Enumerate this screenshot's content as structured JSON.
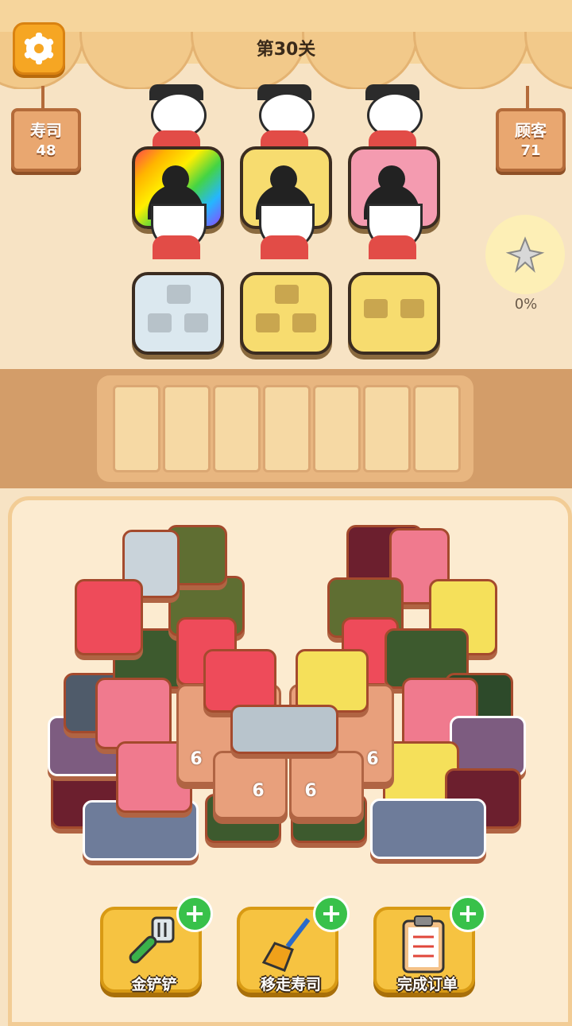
{
  "header": {
    "level_title": "第30关",
    "settings_icon": "gear-icon"
  },
  "signs": {
    "sushi": {
      "label": "寿司",
      "count": "48"
    },
    "customers": {
      "label": "顾客",
      "count": "71"
    }
  },
  "progress": {
    "percent_label": "0%",
    "value": 0
  },
  "orders_top": [
    {
      "box_color": "rainbow"
    },
    {
      "box_color": "#f7dc6f"
    },
    {
      "box_color": "#f49bb0"
    }
  ],
  "orders_front": [
    {
      "box_color": "#dbe8ef",
      "pieces": 3
    },
    {
      "box_color": "#f7dc6f",
      "pieces": 3
    },
    {
      "box_color": "#f7dc6f",
      "pieces": 2
    }
  ],
  "tray": {
    "slots": 7
  },
  "board": {
    "center_counts": [
      "6",
      "6",
      "6",
      "6"
    ]
  },
  "powerups": [
    {
      "label": "金铲铲",
      "icon": "spatula-icon"
    },
    {
      "label": "移走寿司",
      "icon": "broom-icon"
    },
    {
      "label": "完成订单",
      "icon": "clipboard-icon"
    }
  ],
  "colors": {
    "accent": "#f6a623",
    "button": "#f6c341",
    "plus": "#38c14a"
  }
}
